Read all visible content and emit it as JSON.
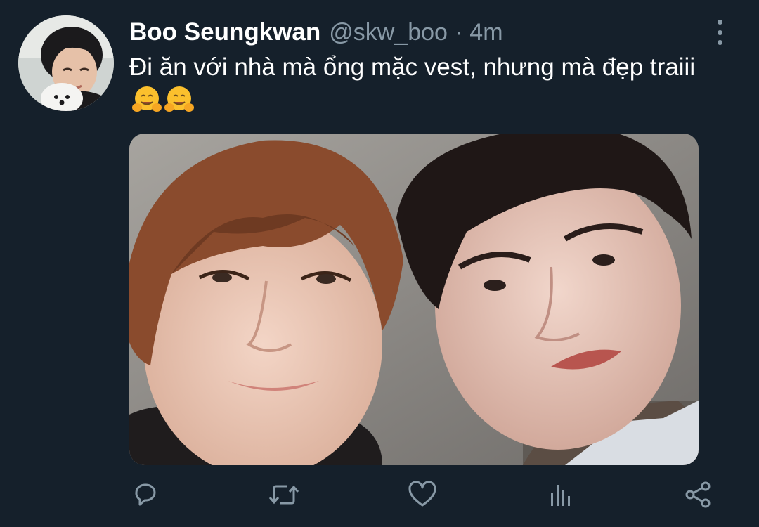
{
  "tweet": {
    "display_name": "Boo Seungkwan",
    "handle": "@skw_boo",
    "separator": "·",
    "time": "4m",
    "text": "Đi ăn với nhà mà ổng mặc vest, nhưng mà đẹp traiii"
  },
  "icons": {
    "more": "more-vertical-icon",
    "reply": "reply-icon",
    "retweet": "retweet-icon",
    "like": "heart-icon",
    "analytics": "analytics-icon",
    "share": "share-icon",
    "emoji": "hugging-face-emoji"
  },
  "colors": {
    "background": "#15202b",
    "primary_text": "#ffffff",
    "secondary_text": "#8899a6",
    "emoji": "#fbc02d"
  }
}
